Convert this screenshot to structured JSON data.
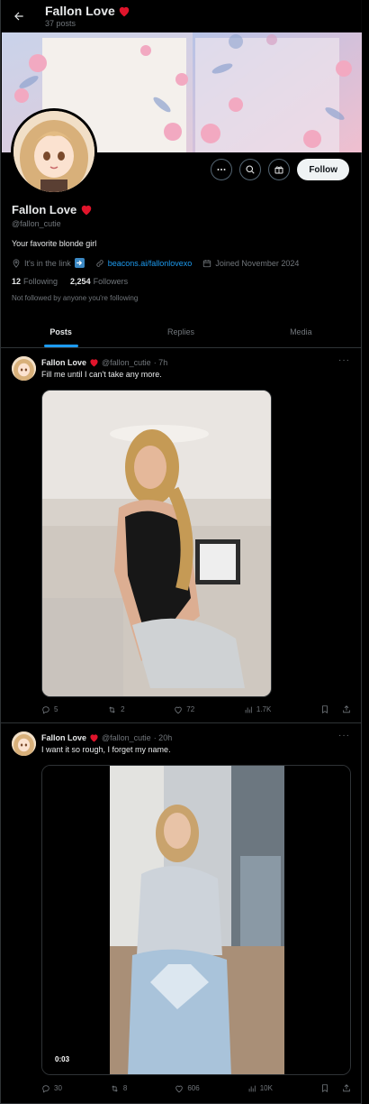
{
  "header": {
    "title": "Fallon Love",
    "post_count": "37 posts"
  },
  "profile": {
    "name": "Fallon Love",
    "handle": "@fallon_cutie",
    "bio": "Your favorite blonde girl",
    "location": "It's in the link",
    "website": "beacons.ai/fallonlovexo",
    "joined": "Joined November 2024",
    "following_count": "12",
    "following_label": "Following",
    "followers_count": "2,254",
    "followers_label": "Followers",
    "followed_note": "Not followed by anyone you're following",
    "follow_button": "Follow"
  },
  "tabs": [
    {
      "label": "Posts",
      "active": true
    },
    {
      "label": "Replies",
      "active": false
    },
    {
      "label": "Media",
      "active": false
    }
  ],
  "posts": [
    {
      "name": "Fallon Love",
      "handle": "@fallon_cutie",
      "time": "· 7h",
      "text": "Fill me until I can't take any more.",
      "replies": "5",
      "reposts": "2",
      "likes": "72",
      "views": "1.7K"
    },
    {
      "name": "Fallon Love",
      "handle": "@fallon_cutie",
      "time": "· 20h",
      "text": "I want it so rough, I forget my name.",
      "video_time": "0:03",
      "replies": "30",
      "reposts": "8",
      "likes": "606",
      "views": "10K"
    }
  ],
  "colors": {
    "accent": "#1d9bf0",
    "heart": "#f91880",
    "muted": "#71767b",
    "border": "#2f3336"
  }
}
